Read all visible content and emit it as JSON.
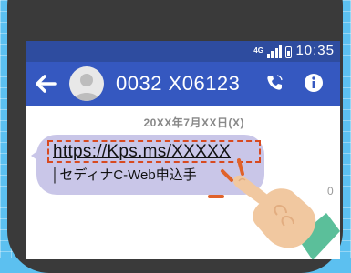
{
  "status_bar": {
    "network": "4G",
    "time": "10:35"
  },
  "header": {
    "title": "0032 X06123"
  },
  "icons": {
    "back": "back-arrow-icon",
    "avatar": "person-avatar-icon",
    "call": "phone-icon",
    "info": "info-icon",
    "hand": "pointing-hand-icon"
  },
  "message": {
    "date": "20XX年7月XX日(X)",
    "link_text": "https://Kps.ms/XXXXX",
    "second_line": "│セディナC-Web申込手",
    "time": "0"
  },
  "colors": {
    "background": "#5cc0f0",
    "status_bar": "#2e4c9f",
    "app_bar": "#3558c0",
    "bubble": "#c9c6e8",
    "highlight": "#d84a20"
  }
}
